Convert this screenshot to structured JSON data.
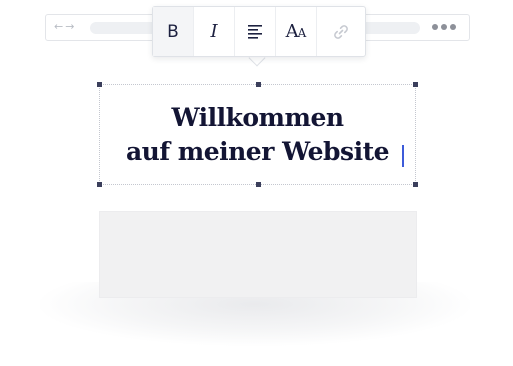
{
  "browser": {
    "back_icon": "←",
    "forward_icon": "→",
    "more_icon": "ellipsis-dots"
  },
  "toolbar": {
    "bold_label": "B",
    "italic_label": "I",
    "align_icon": "align-left-icon",
    "font_label_large": "A",
    "font_label_small": "A",
    "link_icon": "link-icon",
    "active_tool": "bold"
  },
  "editor": {
    "headline_line1": "Willkommen",
    "headline_line2": "auf meiner Website"
  },
  "colors": {
    "headline": "#131534",
    "caret": "#3d5bd9",
    "placeholder": "#f1f1f2"
  }
}
